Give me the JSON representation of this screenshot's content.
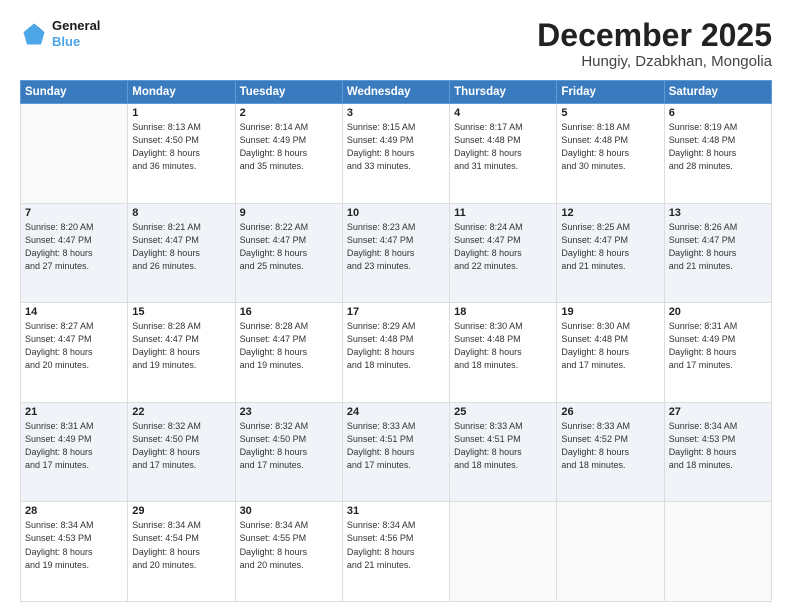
{
  "logo": {
    "line1": "General",
    "line2": "Blue"
  },
  "header": {
    "month": "December 2025",
    "location": "Hungiy, Dzabkhan, Mongolia"
  },
  "weekdays": [
    "Sunday",
    "Monday",
    "Tuesday",
    "Wednesday",
    "Thursday",
    "Friday",
    "Saturday"
  ],
  "weeks": [
    [
      {
        "day": "",
        "info": ""
      },
      {
        "day": "1",
        "info": "Sunrise: 8:13 AM\nSunset: 4:50 PM\nDaylight: 8 hours\nand 36 minutes."
      },
      {
        "day": "2",
        "info": "Sunrise: 8:14 AM\nSunset: 4:49 PM\nDaylight: 8 hours\nand 35 minutes."
      },
      {
        "day": "3",
        "info": "Sunrise: 8:15 AM\nSunset: 4:49 PM\nDaylight: 8 hours\nand 33 minutes."
      },
      {
        "day": "4",
        "info": "Sunrise: 8:17 AM\nSunset: 4:48 PM\nDaylight: 8 hours\nand 31 minutes."
      },
      {
        "day": "5",
        "info": "Sunrise: 8:18 AM\nSunset: 4:48 PM\nDaylight: 8 hours\nand 30 minutes."
      },
      {
        "day": "6",
        "info": "Sunrise: 8:19 AM\nSunset: 4:48 PM\nDaylight: 8 hours\nand 28 minutes."
      }
    ],
    [
      {
        "day": "7",
        "info": "Sunrise: 8:20 AM\nSunset: 4:47 PM\nDaylight: 8 hours\nand 27 minutes."
      },
      {
        "day": "8",
        "info": "Sunrise: 8:21 AM\nSunset: 4:47 PM\nDaylight: 8 hours\nand 26 minutes."
      },
      {
        "day": "9",
        "info": "Sunrise: 8:22 AM\nSunset: 4:47 PM\nDaylight: 8 hours\nand 25 minutes."
      },
      {
        "day": "10",
        "info": "Sunrise: 8:23 AM\nSunset: 4:47 PM\nDaylight: 8 hours\nand 23 minutes."
      },
      {
        "day": "11",
        "info": "Sunrise: 8:24 AM\nSunset: 4:47 PM\nDaylight: 8 hours\nand 22 minutes."
      },
      {
        "day": "12",
        "info": "Sunrise: 8:25 AM\nSunset: 4:47 PM\nDaylight: 8 hours\nand 21 minutes."
      },
      {
        "day": "13",
        "info": "Sunrise: 8:26 AM\nSunset: 4:47 PM\nDaylight: 8 hours\nand 21 minutes."
      }
    ],
    [
      {
        "day": "14",
        "info": "Sunrise: 8:27 AM\nSunset: 4:47 PM\nDaylight: 8 hours\nand 20 minutes."
      },
      {
        "day": "15",
        "info": "Sunrise: 8:28 AM\nSunset: 4:47 PM\nDaylight: 8 hours\nand 19 minutes."
      },
      {
        "day": "16",
        "info": "Sunrise: 8:28 AM\nSunset: 4:47 PM\nDaylight: 8 hours\nand 19 minutes."
      },
      {
        "day": "17",
        "info": "Sunrise: 8:29 AM\nSunset: 4:48 PM\nDaylight: 8 hours\nand 18 minutes."
      },
      {
        "day": "18",
        "info": "Sunrise: 8:30 AM\nSunset: 4:48 PM\nDaylight: 8 hours\nand 18 minutes."
      },
      {
        "day": "19",
        "info": "Sunrise: 8:30 AM\nSunset: 4:48 PM\nDaylight: 8 hours\nand 17 minutes."
      },
      {
        "day": "20",
        "info": "Sunrise: 8:31 AM\nSunset: 4:49 PM\nDaylight: 8 hours\nand 17 minutes."
      }
    ],
    [
      {
        "day": "21",
        "info": "Sunrise: 8:31 AM\nSunset: 4:49 PM\nDaylight: 8 hours\nand 17 minutes."
      },
      {
        "day": "22",
        "info": "Sunrise: 8:32 AM\nSunset: 4:50 PM\nDaylight: 8 hours\nand 17 minutes."
      },
      {
        "day": "23",
        "info": "Sunrise: 8:32 AM\nSunset: 4:50 PM\nDaylight: 8 hours\nand 17 minutes."
      },
      {
        "day": "24",
        "info": "Sunrise: 8:33 AM\nSunset: 4:51 PM\nDaylight: 8 hours\nand 17 minutes."
      },
      {
        "day": "25",
        "info": "Sunrise: 8:33 AM\nSunset: 4:51 PM\nDaylight: 8 hours\nand 18 minutes."
      },
      {
        "day": "26",
        "info": "Sunrise: 8:33 AM\nSunset: 4:52 PM\nDaylight: 8 hours\nand 18 minutes."
      },
      {
        "day": "27",
        "info": "Sunrise: 8:34 AM\nSunset: 4:53 PM\nDaylight: 8 hours\nand 18 minutes."
      }
    ],
    [
      {
        "day": "28",
        "info": "Sunrise: 8:34 AM\nSunset: 4:53 PM\nDaylight: 8 hours\nand 19 minutes."
      },
      {
        "day": "29",
        "info": "Sunrise: 8:34 AM\nSunset: 4:54 PM\nDaylight: 8 hours\nand 20 minutes."
      },
      {
        "day": "30",
        "info": "Sunrise: 8:34 AM\nSunset: 4:55 PM\nDaylight: 8 hours\nand 20 minutes."
      },
      {
        "day": "31",
        "info": "Sunrise: 8:34 AM\nSunset: 4:56 PM\nDaylight: 8 hours\nand 21 minutes."
      },
      {
        "day": "",
        "info": ""
      },
      {
        "day": "",
        "info": ""
      },
      {
        "day": "",
        "info": ""
      }
    ]
  ]
}
